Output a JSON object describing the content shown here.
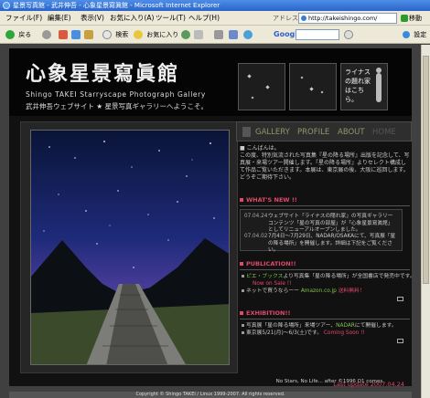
{
  "window": {
    "title": "星景写真館 - 武井伸吾 - 心象星景寫眞館 - Microsoft Internet Explorer"
  },
  "menu": [
    "ファイル(F)",
    "編集(E)",
    "表示(V)",
    "お気に入り(A)",
    "ツール(T)",
    "ヘルプ(H)"
  ],
  "address": {
    "label": "アドレス(D)",
    "url": "http://takeishingo.com/",
    "go": "移動"
  },
  "toolbar": {
    "back": "戻る",
    "search": "検索",
    "favorites": "お気に入り",
    "google": "Google",
    "settings": "設定"
  },
  "site": {
    "logo": "心象星景寫眞館",
    "subtitle_en": "Shingo TAKEI Starryscape Photograph Gallery",
    "subtitle_ja": "武井伸吾ウェブサイト ★ 星景写真ギャラリーへようこそ。",
    "thumb3_text": "ライナスの題れ家はこちら。"
  },
  "nav": {
    "gallery": "GALLERY",
    "profile": "PROFILE",
    "about": "ABOUT",
    "home": "HOME"
  },
  "intro": {
    "line1": "■ こんばんは。",
    "body": "この度、特別気流された写真集『星の降る場所』出版を記念して、写真展・来場ツアー開催します。『星の降る場所』よりセレクト構成して作品ご覧いただきます。本展は、東京展の後、大阪に巡回します。どうぞご期待下さい。"
  },
  "whatsnew": {
    "title": "WHAT'S NEW !!",
    "items": [
      {
        "date": "07.04.24",
        "text": "ウェブサイト「ライナスの隠れ家」の写真ギャラリーコンテンツ「星の写真の部屋」が「心象星景寫眞館」としてリニューアルオープンしました。"
      },
      {
        "date": "07.04.02",
        "text": "7月4日～7月29日、NADAR/OSAKAにて、写真展「星の降る場所」を開催します。詳細は下記をご覧ください。"
      }
    ]
  },
  "publication": {
    "title": "PUBLICATION!!",
    "line1_pre": "ピエ・ブックス",
    "line1_post": "より写真集「星の降る場所」が全国書店で発売中です。",
    "line2": "Now on Sale !!",
    "line3_pre": "ネットで買うならーー",
    "line3_link": "Amazon.co.jp",
    "line3_post": "送料無料！"
  },
  "exhibition": {
    "title": "EXHIBITION!!",
    "line1": "写真展「星の降る場所」来場ツアー、",
    "line1_link": "NADAR",
    "line1_post": "にて開催します。",
    "line2": "東京展5/21(月)～6/3(土)です。",
    "line2_link": "Coming Soon !!"
  },
  "last_update": "Last update 2007.04.24",
  "footer": {
    "tagline": "No Stars, No Life... after ©1996 O1 comes.",
    "copyright": "Copyright © Shingo TAKEI / Linux 1999-2007. All rights reserved."
  }
}
